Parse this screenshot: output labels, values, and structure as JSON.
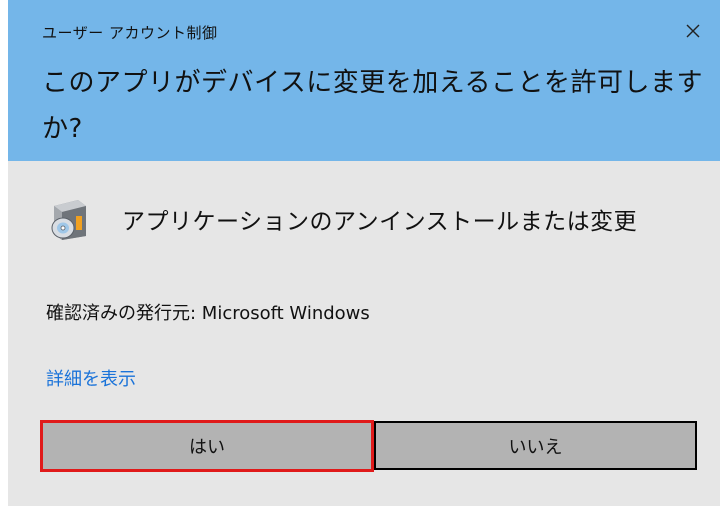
{
  "header": {
    "title": "ユーザー アカウント制御",
    "question": "このアプリがデバイスに変更を加えることを許可しますか?",
    "close_icon": "close-icon",
    "background_color": "#74b6e9"
  },
  "app": {
    "icon": "installer-disc-icon",
    "name": "アプリケーションのアンインストールまたは変更"
  },
  "publisher": {
    "text": "確認済みの発行元: Microsoft Windows"
  },
  "details": {
    "link_text": "詳細を表示",
    "color": "#1a73d9"
  },
  "buttons": {
    "yes_label": "はい",
    "no_label": "いいえ",
    "highlight_color": "#e01a1a"
  }
}
